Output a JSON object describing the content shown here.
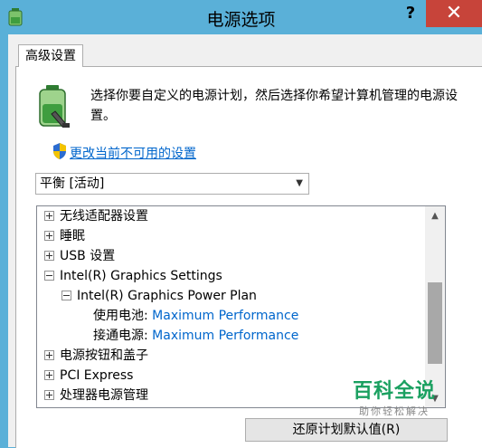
{
  "window": {
    "title": "电源选项",
    "help_label": "?",
    "close_label": "✕",
    "icon": "power-options-icon"
  },
  "tab": {
    "label": "高级设置"
  },
  "description": "选择你要自定义的电源计划，然后选择你希望计算机管理的电源设置。",
  "change_link": "更改当前不可用的设置",
  "plan_select": {
    "value": "平衡 [活动]"
  },
  "tree": {
    "items": [
      {
        "label": "无线适配器设置",
        "state": "collapsed"
      },
      {
        "label": "睡眠",
        "state": "collapsed"
      },
      {
        "label": "USB 设置",
        "state": "collapsed"
      },
      {
        "label": "Intel(R) Graphics Settings",
        "state": "expanded"
      },
      {
        "label": "Intel(R) Graphics Power Plan",
        "state": "expanded"
      },
      {
        "label": "使用电池:",
        "value": "Maximum Performance"
      },
      {
        "label": "接通电源:",
        "value": "Maximum Performance"
      },
      {
        "label": "电源按钮和盖子",
        "state": "collapsed"
      },
      {
        "label": "PCI Express",
        "state": "collapsed"
      },
      {
        "label": "处理器电源管理",
        "state": "collapsed"
      }
    ]
  },
  "restore_button": "还原计划默认值(R)",
  "watermark": {
    "line1": "百科全说",
    "line2": "助你轻松解决"
  },
  "colors": {
    "titlebar": "#5ab0d8",
    "close": "#c7443a",
    "link": "#0066cc"
  }
}
